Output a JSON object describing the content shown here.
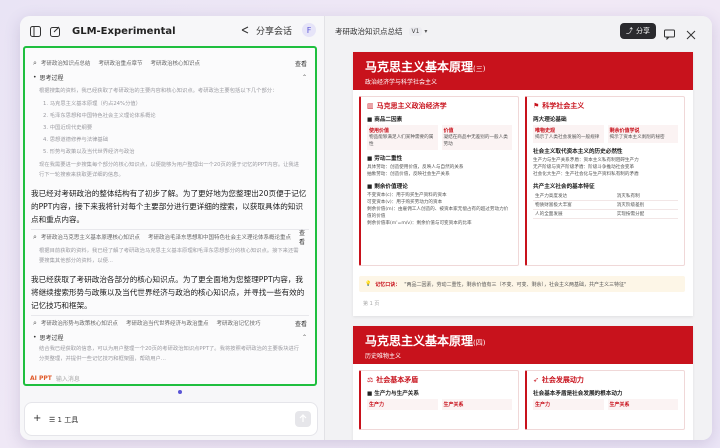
{
  "app": {
    "title": "GLM-Experimental",
    "share_conversation": "分享会话",
    "avatar": "F"
  },
  "chat": {
    "search1": {
      "terms": [
        "考研政治知识点总结",
        "考研政治重点章节",
        "考研政治核心知识点"
      ],
      "view": "查看"
    },
    "ref1": {
      "label": "思考过程"
    },
    "ref1_intro": "根据搜集的资料，我已经获取了考研政治的主要内容和核心知识点。考研政治主要包括以下几个部分：",
    "ref1_list": [
      "马克思主义基本原理（约占24%分值）",
      "毛泽东思想和中国特色社会主义理论体系概论",
      "中国近现代史纲要",
      "思想道德修养与法律基础",
      "形势与政策以及当代世界经济与政治"
    ],
    "ref1_tail": "现在我需要进一步搜集每个部分的核心知识点，以便能够为用户整理出一个20页的便于记忆的PPT内容。让我进行下一轮搜索来获取更详细的信息。",
    "msg1": "我已经对考研政治的整体结构有了初步了解。为了更好地为您整理出20页便于记忆的PPT内容，接下来我将针对每个主要部分进行更详细的搜索，以获取具体的知识点和重点内容。",
    "search2": {
      "terms": [
        "考研政治马克思主义基本原理核心知识点",
        "考研政治毛泽东思想和中国特色社会主义理论体系概论重点"
      ],
      "view": "查看"
    },
    "ref2_text": "根据目前获取的资料，我已经了解了考研政治马克思主义基本原理和毛泽东思想部分的核心知识点。接下来还需要搜集其他部分的资料，以便...",
    "msg2": "我已经获取了考研政治各部分的核心知识点。为了更全面地为您整理PPT内容，我将继续搜索形势与政策以及当代世界经济与政治的核心知识点，并寻找一些有效的记忆技巧和框架。",
    "search3": {
      "terms": [
        "考研政治形势与政策核心知识点",
        "考研政治当代世界经济与政治重点",
        "考研政治记忆技巧"
      ],
      "view": "查看"
    },
    "ref3": {
      "label": "思考过程"
    },
    "ref3_text": "结合我已经获取的信息，可以为用户整理一个20页的考研政治知识点PPT了。我将按照考研政治的主要板块进行分类整理，并提供一些记忆技巧和框架图，帮助用户...",
    "aippt_tag": "AI PPT",
    "aippt_text": "输入消息"
  },
  "input": {
    "tool_label": "1 工具"
  },
  "doc": {
    "title": "考研政治知识点总结",
    "version": "V1",
    "share": "分享"
  },
  "slide1": {
    "title": "马克思主义基本原理",
    "title_suffix": "(三)",
    "subtitle": "政治经济学与科学社会主义",
    "left_head": "马克思主义政治经济学",
    "left_sec1": "商品二因素",
    "use_value_h": "使用价值",
    "use_value_t": "物品能够满足人们某种需要的属性",
    "value_h": "价值",
    "value_t": "凝结在商品中无差别的一般人类劳动",
    "left_sec2": "劳动二重性",
    "concrete": "具体劳动：创造使用价值，反映人与自然的关系",
    "abstract": "抽象劳动：创造价值，反映社会生产关系",
    "left_sec3": "剩余价值理论",
    "sv1": "不变资本(c)：用于购买生产资料的资本",
    "sv2": "可变资本(v)：用于购买劳动力的资本",
    "sv3": "剩余价值(m)：由雇佣工人创造的、被资本家无偿占有的超过劳动力价值的价值",
    "sv4": "剩余价值率(m'=m/v)：剩余价值与可变资本的比率",
    "right_head": "科学社会主义",
    "right_sec1": "两大理论基础",
    "hist_mat_h": "唯物史观",
    "hist_mat_t": "揭示了人类社会发展的一般规律",
    "surplus_h": "剩余价值学说",
    "surplus_t": "揭示了资本主义剥削的秘密",
    "right_sec2": "社会主义取代资本主义的历史必然性",
    "r1": "生产力与生产关系矛盾：资本主义私有制阻碍生产力",
    "r2": "无产阶级与资产阶级矛盾：阶级斗争推动社会变革",
    "r3": "社会化大生产：生产社会化与生产资料私有制的矛盾",
    "right_sec3": "共产主义社会的基本特征",
    "t_rows": [
      [
        "生产力高度发达",
        "消灭私有制"
      ],
      [
        "物质财富极大丰富",
        "消灭阶级差别"
      ],
      [
        "人的全面发展",
        "实现按需分配"
      ]
    ],
    "memo_label": "记忆口诀：",
    "memo_text": "\"两品二因素，劳动二重性，剩余价值有三（不变、可变、剩余），社会主义两基础，共产主义三特征\"",
    "page": "第 1 页"
  },
  "slide2": {
    "title": "马克思主义基本原理",
    "title_suffix": "(四)",
    "subtitle": "历史唯物主义",
    "left_head": "社会基本矛盾",
    "left_sub": "生产力与生产关系",
    "lc1": "生产力",
    "lc2": "生产关系",
    "right_head": "社会发展动力",
    "right_sub": "社会基本矛盾是社会发展的根本动力",
    "rc1": "生产力",
    "rc2": "生产关系"
  }
}
